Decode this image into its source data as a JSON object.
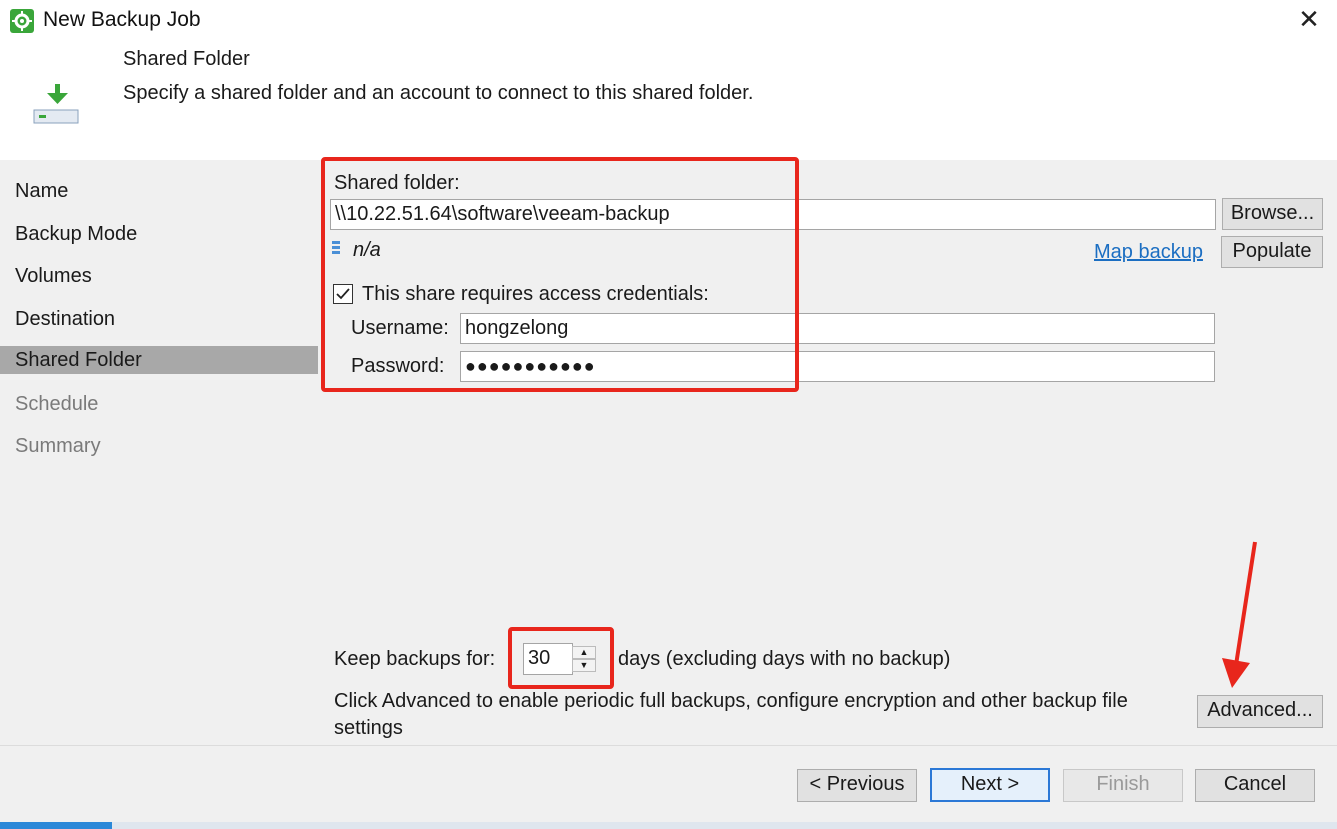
{
  "window": {
    "title": "New Backup Job",
    "app_icon": "veeam-gear-icon",
    "close_icon": "close-icon"
  },
  "header": {
    "step_title": "Shared Folder",
    "step_description": "Specify a shared folder and an account to connect to this shared folder.",
    "icon": "download-to-storage-icon"
  },
  "sidebar": {
    "items": [
      {
        "label": "Name",
        "state": "done"
      },
      {
        "label": "Backup Mode",
        "state": "done"
      },
      {
        "label": "Volumes",
        "state": "done"
      },
      {
        "label": "Destination",
        "state": "done"
      },
      {
        "label": "Shared Folder",
        "state": "active"
      },
      {
        "label": "Schedule",
        "state": "disabled"
      },
      {
        "label": "Summary",
        "state": "disabled"
      }
    ]
  },
  "shared_folder": {
    "label": "Shared folder:",
    "value": "\\\\10.22.51.64\\software\\veeam-backup",
    "browse_button": "Browse...",
    "status_icon": "database-icon",
    "status_text": "n/a",
    "map_backup_link": "Map backup",
    "populate_button": "Populate"
  },
  "credentials": {
    "checkbox_label": "This share requires access credentials:",
    "checked": true,
    "username_label": "Username:",
    "username_value": "hongzelong",
    "password_label": "Password:",
    "password_value": "●●●●●●●●●●●"
  },
  "retention": {
    "label": "Keep backups for:",
    "value": "30",
    "suffix": "days (excluding days with no backup)"
  },
  "advanced": {
    "hint": "Click Advanced to enable periodic full backups, configure encryption and other backup file settings",
    "button": "Advanced..."
  },
  "footer": {
    "previous": "< Previous",
    "next": "Next >",
    "finish": "Finish",
    "cancel": "Cancel"
  },
  "colors": {
    "highlight_red": "#e8261c",
    "link_blue": "#1b6ec2",
    "active_nav": "#a8a8a8",
    "brand_green": "#3aa63a"
  }
}
